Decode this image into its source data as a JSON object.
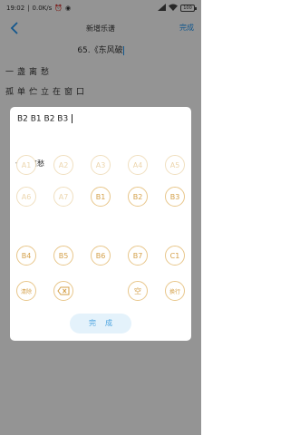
{
  "status": {
    "time": "19:02",
    "speed": "0.0K/s",
    "battery": "100"
  },
  "nav": {
    "title": "新增乐谱",
    "done": "完成"
  },
  "song": {
    "title": "65.《东风破"
  },
  "lyrics": [
    "一盏离愁",
    "孤单伫立在窗口"
  ],
  "dialog": {
    "input_value": "B2 B1 B2 B3 ",
    "lyric_label": "一盏离愁",
    "keys": [
      {
        "label": "A1",
        "state": "disabled"
      },
      {
        "label": "A2",
        "state": "disabled"
      },
      {
        "label": "A3",
        "state": "disabled"
      },
      {
        "label": "A4",
        "state": "disabled"
      },
      {
        "label": "A5",
        "state": "disabled"
      },
      {
        "label": "A6",
        "state": "disabled"
      },
      {
        "label": "A7",
        "state": "disabled"
      },
      {
        "label": "B1",
        "state": "enabled"
      },
      {
        "label": "B2",
        "state": "enabled"
      },
      {
        "label": "B3",
        "state": "enabled"
      },
      {
        "label": "B4",
        "state": "enabled"
      },
      {
        "label": "B5",
        "state": "enabled"
      },
      {
        "label": "B6",
        "state": "enabled"
      },
      {
        "label": "B7",
        "state": "enabled"
      },
      {
        "label": "C1",
        "state": "enabled"
      },
      {
        "label": "清除",
        "state": "enabled"
      },
      {
        "label": "",
        "icon": "backspace-icon",
        "state": "enabled"
      },
      {
        "label": "空",
        "state": "enabled"
      },
      {
        "label": "换行",
        "state": "enabled"
      }
    ],
    "done_label": "完成"
  },
  "colors": {
    "accent": "#2196f3",
    "key_gold": "#d4a04a",
    "done_bg": "#e4f2fb"
  }
}
